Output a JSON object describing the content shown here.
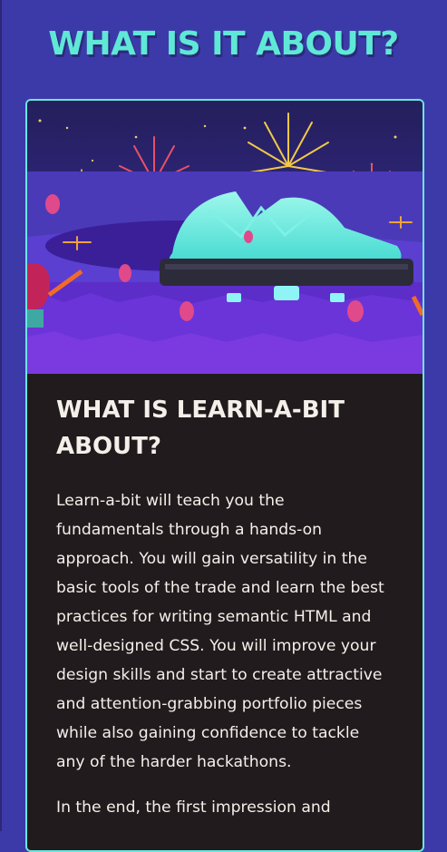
{
  "section": {
    "title": "WHAT IS IT ABOUT?"
  },
  "card": {
    "image_alt": "Illustrated festival dome at night with fireworks, hot air balloons and drones",
    "heading": "WHAT IS LEARN-A-BIT ABOUT?",
    "paragraphs": [
      "Learn-a-bit will teach you the fundamentals through a hands-on approach. You will gain versatility in the basic tools of the trade and learn the best practices for writing semantic HTML and well-designed CSS. You will improve your design skills and start to create attractive and attention-grabbing portfolio pieces while also gaining confidence to tackle any of the harder hackathons.",
      "In the end, the first impression and"
    ]
  },
  "colors": {
    "background": "#3c3aa8",
    "title": "#5fe8d6",
    "card_bg": "#211b1d",
    "card_border": "#6ae6e0",
    "text": "#f3f0ea"
  }
}
